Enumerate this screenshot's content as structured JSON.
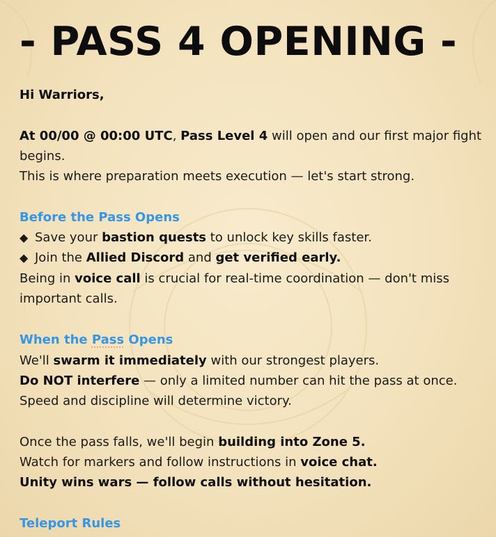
{
  "doc": {
    "title": "- PASS 4 OPENING -",
    "greeting": "Hi Warriors,",
    "intro": {
      "p1_b1": "At 00/00 @ 00:00 UTC",
      "p1_t1": ", ",
      "p1_b2": "Pass Level 4",
      "p1_t2": " will open and our first major fight",
      "p2": "begins.",
      "p3": "This is where preparation meets execution — let's start strong."
    },
    "before": {
      "heading": "Before the Pass Opens",
      "bullet_symbol": "◆",
      "b1_t1": "Save your ",
      "b1_b1": "bastion quests",
      "b1_t2": " to unlock key skills faster.",
      "b2_t1": "Join the ",
      "b2_b1": "Allied Discord",
      "b2_t2": " and ",
      "b2_b2": "get verified early.",
      "l3_t1": "Being in ",
      "l3_b1": "voice call",
      "l3_t2": " is crucial for real-time coordination — don't miss",
      "l4": "important calls."
    },
    "when": {
      "heading_a": "When the ",
      "heading_b": "Pass",
      "heading_c": " Opens",
      "l1_t1": "We'll ",
      "l1_b1": "swarm it immediately",
      "l1_t2": " with our strongest players.",
      "l2_b1": "Do NOT interfere",
      "l2_t1": " — only a limited number can hit the pass at once.",
      "l3": "Speed and discipline will determine victory.",
      "l4_t1": "Once the pass falls, we'll begin ",
      "l4_b1": "building into Zone 5.",
      "l5_t1": "Watch for markers and follow instructions in ",
      "l5_b1": "voice chat.",
      "l6_b1": "Unity wins wars — follow calls without hesitation."
    },
    "teleport": {
      "heading": "Teleport Rules"
    }
  },
  "colors": {
    "heading": "#3596e6",
    "text": "#1a1a1a",
    "background": "#f3e2bd"
  }
}
